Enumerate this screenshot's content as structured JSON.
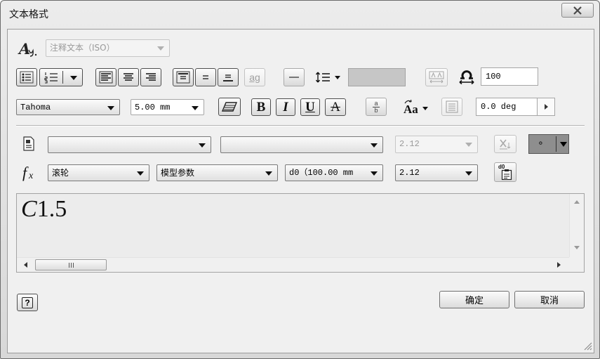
{
  "window": {
    "title": "文本格式"
  },
  "style_row": {
    "style_glyph": "A",
    "text_style": "注释文本（ISO）"
  },
  "paragraph_row": {
    "stack_label": "ag",
    "width_factor": "100",
    "text_color": "#c6c6c6"
  },
  "font_row": {
    "font": "Tahoma",
    "size": "5.00 mm",
    "bold_label": "B",
    "italic_label": "I",
    "underline_label": "U",
    "strikethrough_label": "A",
    "fraction_top": "a",
    "fraction_bottom": "b",
    "case_label": "Aa",
    "rotation": "0.0 deg"
  },
  "symbol_row": {
    "precision": "2.12",
    "symbol": "∘",
    "symbol_bg": "#8e8e8e"
  },
  "parameter_row": {
    "fx_base": "f",
    "fx_sub": "x",
    "component": "滚轮",
    "source": "模型参数",
    "parameter": "d0（100.00 mm",
    "precision": "2.12",
    "insert_label": "d0"
  },
  "editor": {
    "prefix": "C",
    "value": "1.5"
  },
  "footer": {
    "help_label": "?",
    "ok": "确定",
    "cancel": "取消"
  },
  "icons": [
    "close-icon",
    "text-style-icon",
    "bullet-list-icon",
    "numbered-list-icon",
    "align-left-icon",
    "align-center-icon",
    "align-right-icon",
    "valign-top-icon",
    "valign-middle-icon",
    "valign-bottom-icon",
    "line-icon",
    "line-spacing-icon",
    "text-fit-icon",
    "width-factor-icon",
    "oblique-icon",
    "text-box-icon",
    "spin-right-icon",
    "symbol-list-icon",
    "precision-format-icon",
    "function-icon",
    "insert-parameter-icon",
    "help-icon",
    "resize-grip-icon"
  ]
}
